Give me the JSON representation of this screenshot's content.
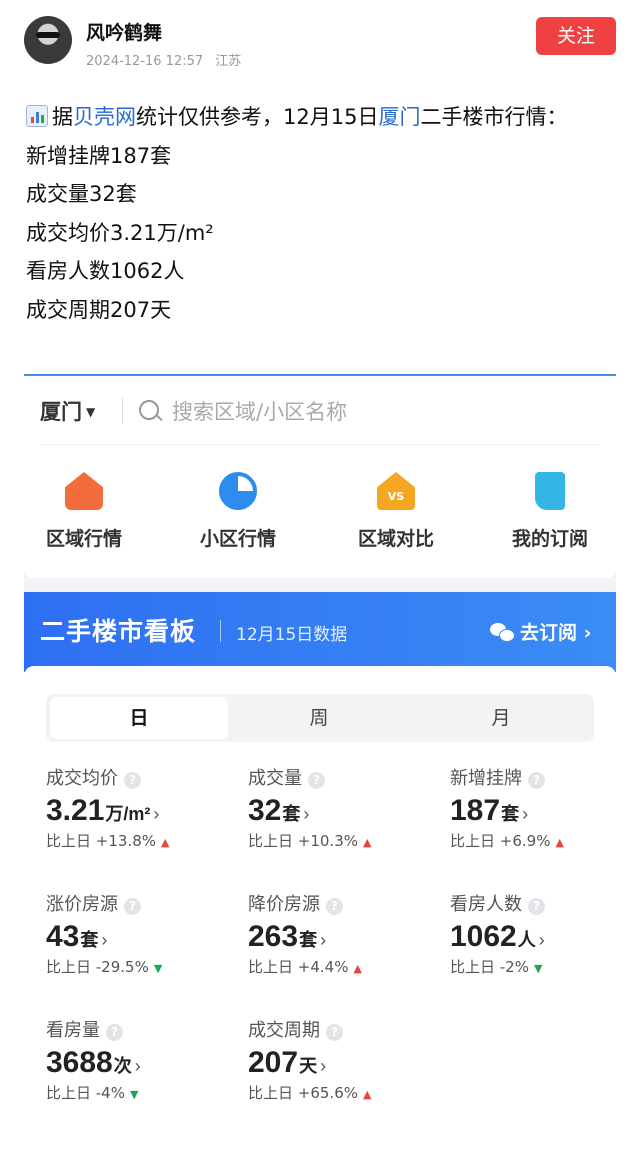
{
  "author": {
    "name": "风吟鹤舞",
    "date": "2024-12-16 12:57",
    "location": "江苏",
    "follow_label": "关注"
  },
  "post": {
    "icon": "bar-chart-emoji-icon",
    "line1_pre": "据",
    "line1_link1": "贝壳网",
    "line1_mid": "统计仅供参考，12月15日",
    "line1_link2": "厦门",
    "line1_post": "二手楼市行情：",
    "lines": [
      "新增挂牌187套",
      "成交量32套",
      "成交均价3.21万/m²",
      "看房人数1062人",
      "成交周期207天"
    ]
  },
  "embed": {
    "city": "厦门",
    "search_placeholder": "搜索区域/小区名称",
    "nav": [
      {
        "label": "区域行情",
        "icon": "house-trend-icon"
      },
      {
        "label": "小区行情",
        "icon": "pie-chart-icon"
      },
      {
        "label": "区域对比",
        "icon": "house-vs-icon",
        "badge": "VS"
      },
      {
        "label": "我的订阅",
        "icon": "bookmark-icon"
      }
    ],
    "banner": {
      "title": "二手楼市看板",
      "date": "12月15日数据",
      "subscribe": "去订阅 ›"
    },
    "tabs": [
      "日",
      "周",
      "月"
    ],
    "stats": [
      {
        "label": "成交均价",
        "value": "3.21",
        "unit": "万/m²",
        "change": "比上日 +13.8%",
        "trend": "up"
      },
      {
        "label": "成交量",
        "value": "32",
        "unit": "套",
        "change": "比上日 +10.3%",
        "trend": "up"
      },
      {
        "label": "新增挂牌",
        "value": "187",
        "unit": "套",
        "change": "比上日 +6.9%",
        "trend": "up"
      },
      {
        "label": "涨价房源",
        "value": "43",
        "unit": "套",
        "change": "比上日 -29.5%",
        "trend": "down"
      },
      {
        "label": "降价房源",
        "value": "263",
        "unit": "套",
        "change": "比上日 +4.4%",
        "trend": "up"
      },
      {
        "label": "看房人数",
        "value": "1062",
        "unit": "人",
        "change": "比上日 -2%",
        "trend": "down"
      },
      {
        "label": "看房量",
        "value": "3688",
        "unit": "次",
        "change": "比上日 -4%",
        "trend": "down"
      },
      {
        "label": "成交周期",
        "value": "207",
        "unit": "天",
        "change": "比上日 +65.6%",
        "trend": "up"
      }
    ],
    "colors": {
      "accent": "#2e6ff2",
      "follow": "#f04142",
      "up": "#e8453c",
      "down": "#1fa45a"
    }
  }
}
